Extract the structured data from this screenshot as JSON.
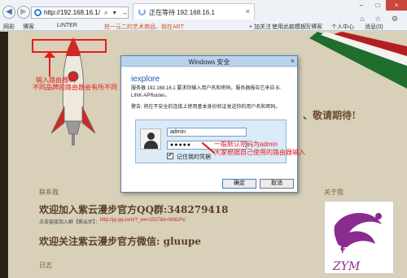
{
  "browser": {
    "url": "http://192.168.16.1/",
    "address_tools": "⌕ ▾ →",
    "tab_title": "正在等待 192.168.16.1",
    "tab_close": "×",
    "window_controls": [
      "–",
      "□",
      "×"
    ],
    "right_icons": "⌂ ☆ ⚙"
  },
  "favorites": {
    "items": [
      "网彩",
      "博客",
      "LINTER",
      "抢一元二的艺术商品、就在ART",
      "+ 加关注",
      "使用此款模板",
      "写博客",
      "个人中心",
      "消息(0)"
    ]
  },
  "annotations": {
    "input_ip": "输入路由器IP,",
    "brand_note": "不同品牌的路由器会有所不同",
    "default_password": "一般默认密码为admin",
    "user_input": "大家根据自己使用的路由器输入"
  },
  "page": {
    "right_heading": "、敬请期待!",
    "contact_label": "联系我",
    "about_label": "关于我",
    "qq_title": "欢迎加入紫云漫步官方QQ群:348279418",
    "qq_link_label": "点击链接加入群【紫云步】：",
    "qq_link": "http://jq.qq.com/?_wv=1027&k=Wd1Psi",
    "wechat_title": "欢迎关注紫云漫步官方微信: gluupe",
    "diary_label": "日志",
    "watermark": "Bai百度"
  },
  "dialog": {
    "title": "Windows 安全",
    "close": "×",
    "app": "iexplore",
    "message": "服务器 192.168.16.1 要求你输入用户名和密码。服务器报告它来自 B-LINK-APRouter。",
    "warning": "警告: 将在不安全的连接上使用基本身份验证发送你的用户名和密码。",
    "username": "admin",
    "password": "●●●●●",
    "remember": "记住我的凭据",
    "check": "✔",
    "ok": "确定",
    "cancel": "取消"
  },
  "colors": {
    "annotation_red": "#e51c1c",
    "dialog_title": "#b9d3ee"
  }
}
